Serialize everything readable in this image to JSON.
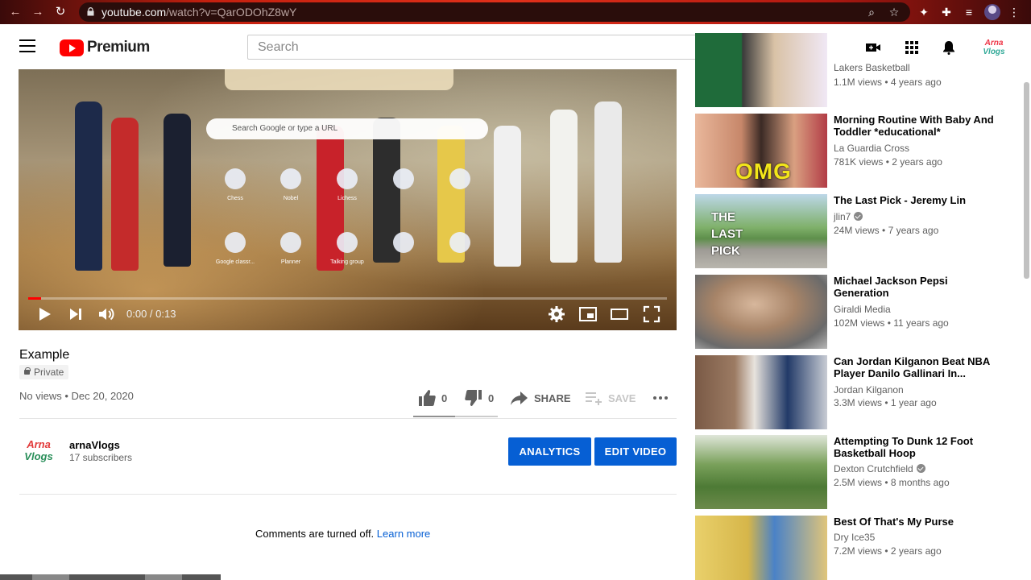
{
  "browser": {
    "url_domain": "youtube.com",
    "url_path": "/watch?v=QarODOhZ8wY"
  },
  "header": {
    "logo_text": "Premium",
    "search_placeholder": "Search"
  },
  "player": {
    "time": "0:00 / 0:13",
    "progress": 0.01,
    "newtab_search_placeholder": "Search Google or type a URL",
    "shortcuts_row1": [
      "Chess",
      "Nobel",
      "Lichess",
      "",
      ""
    ],
    "shortcuts_row2": [
      "Google classr...",
      "Planner",
      "Talking group",
      "",
      ""
    ]
  },
  "video": {
    "title": "Example",
    "privacy": "Private",
    "views": "No views",
    "date": "Dec 20, 2020",
    "likes": "0",
    "dislikes": "0",
    "share_label": "SHARE",
    "save_label": "SAVE"
  },
  "channel": {
    "avatar_text_top": "Arna",
    "avatar_text_bottom": "Vlogs",
    "name": "arnaVlogs",
    "subscribers": "17 subscribers",
    "analytics_label": "ANALYTICS",
    "edit_label": "EDIT VIDEO"
  },
  "comments": {
    "text": "Comments are turned off.",
    "link": "Learn more"
  },
  "sidebar": [
    {
      "title": "",
      "channel": "Lakers Basketball",
      "views": "1.1M views",
      "age": "4 years ago",
      "verified": false
    },
    {
      "title": "Morning Routine With Baby And Toddler *educational*",
      "channel": "La Guardia Cross",
      "views": "781K views",
      "age": "2 years ago",
      "verified": false,
      "thumb_text": "OMG"
    },
    {
      "title": "The Last Pick - Jeremy Lin",
      "channel": "jlin7",
      "views": "24M views",
      "age": "7 years ago",
      "verified": true,
      "thumb_text": "THE LAST PICK"
    },
    {
      "title": "Michael Jackson Pepsi Generation",
      "channel": "Giraldi Media",
      "views": "102M views",
      "age": "11 years ago",
      "verified": false
    },
    {
      "title": "Can Jordan Kilganon Beat NBA Player Danilo Gallinari In...",
      "channel": "Jordan Kilganon",
      "views": "3.3M views",
      "age": "1 year ago",
      "verified": false
    },
    {
      "title": "Attempting To Dunk 12 Foot Basketball Hoop",
      "channel": "Dexton Crutchfield",
      "views": "2.5M views",
      "age": "8 months ago",
      "verified": true
    },
    {
      "title": "Best Of That's My Purse",
      "channel": "Dry Ice35",
      "views": "7.2M views",
      "age": "2 years ago",
      "verified": false
    }
  ],
  "colors": {
    "brand_red": "#ff0000",
    "blue_button": "#065fd4",
    "link": "#065fd4"
  }
}
